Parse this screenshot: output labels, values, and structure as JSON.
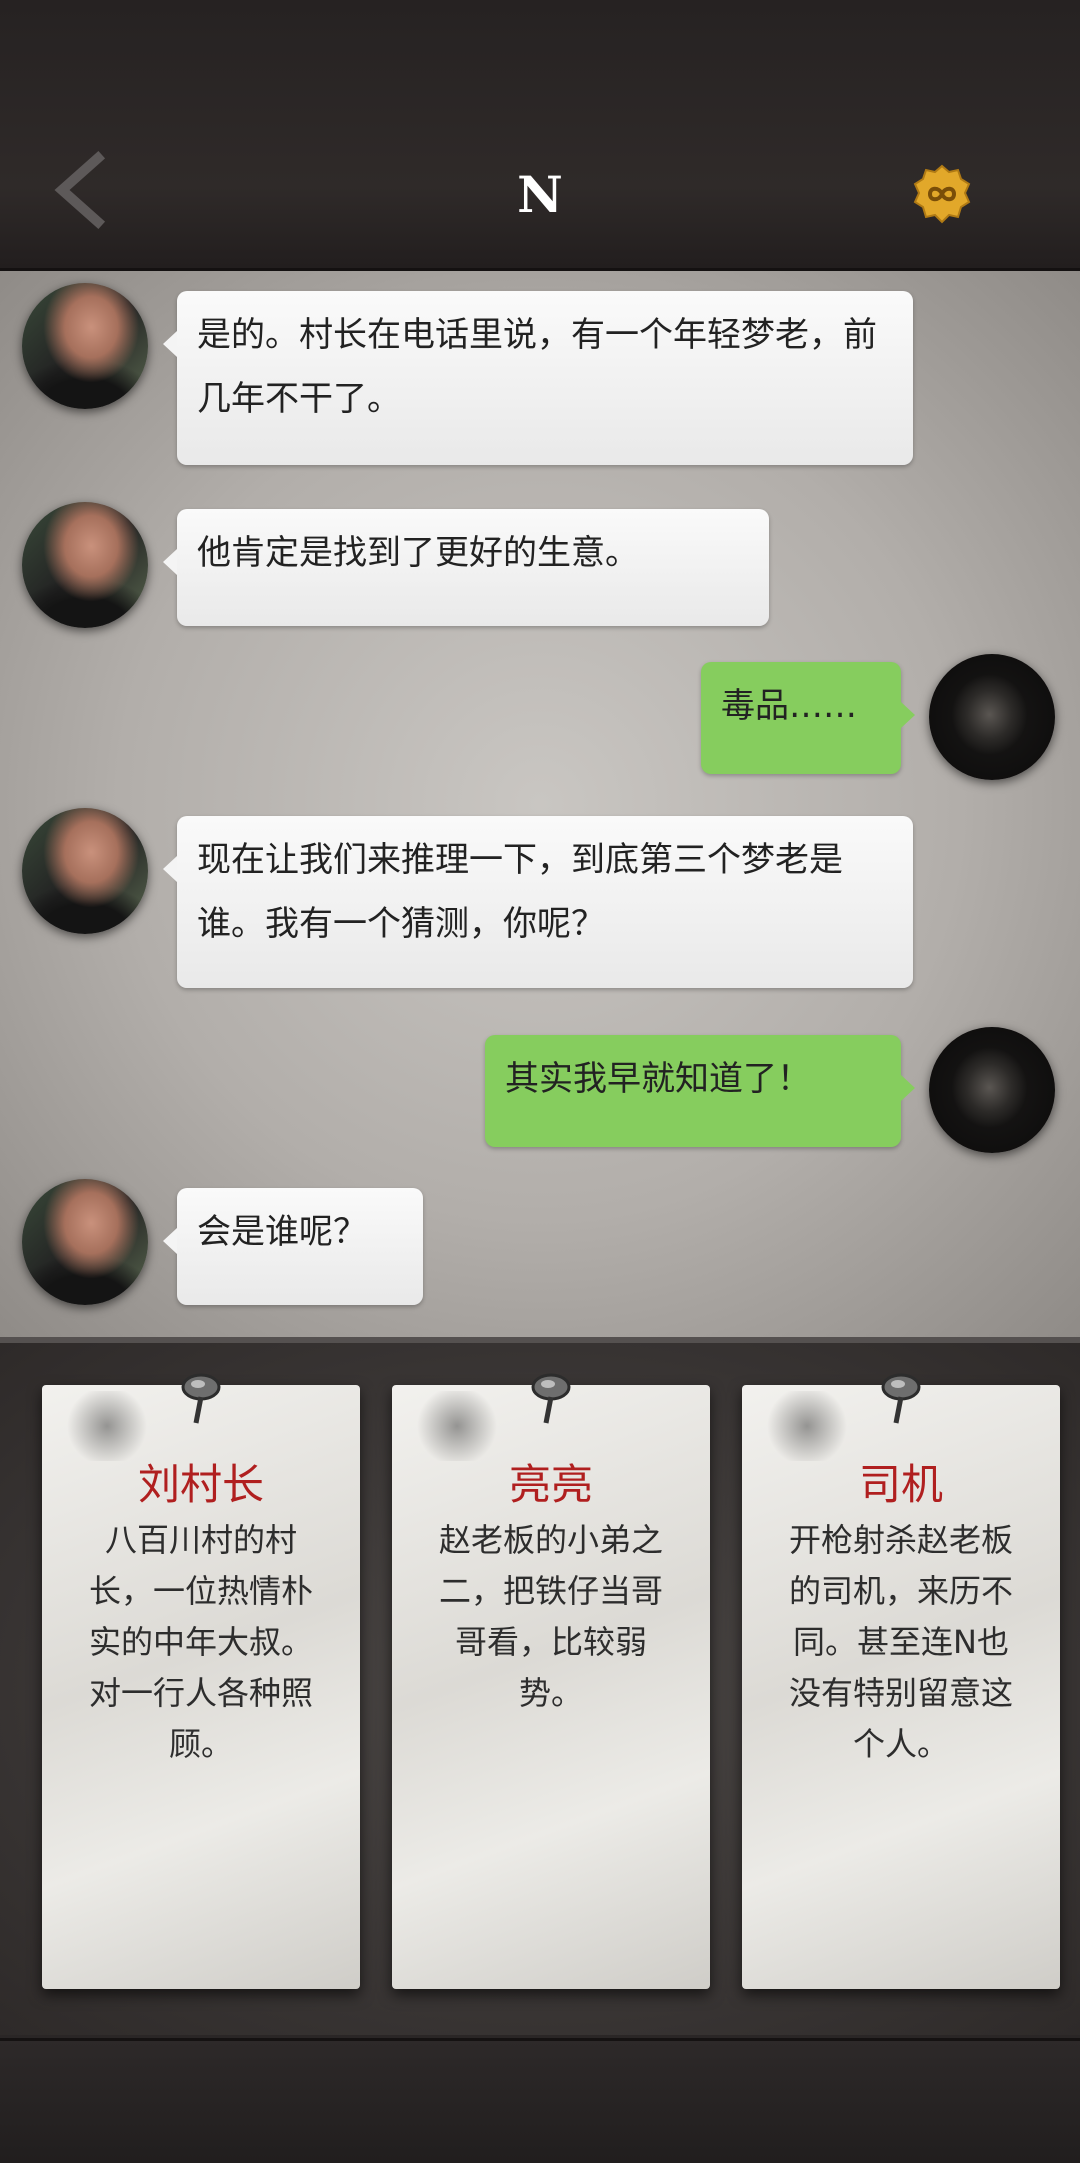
{
  "header": {
    "title": "N",
    "back_icon": "chevron-left-icon",
    "coin_icon": "gold-infinity-coin-icon"
  },
  "messages": [
    {
      "side": "left",
      "text": "是的。村长在电话里说，有一个年轻梦老，前几年不干了。"
    },
    {
      "side": "left",
      "text": "他肯定是找到了更好的生意。"
    },
    {
      "side": "right",
      "text": "毒品……"
    },
    {
      "side": "left",
      "text": "现在让我们来推理一下，到底第三个梦老是谁。我有一个猜测，你呢？"
    },
    {
      "side": "right",
      "text": "其实我早就知道了！"
    },
    {
      "side": "left",
      "text": "会是谁呢？"
    }
  ],
  "cards": [
    {
      "name": "刘村长",
      "desc": "八百川村的村长，一位热情朴实的中年大叔。对一行人各种照顾。"
    },
    {
      "name": "亮亮",
      "desc": "赵老板的小弟之二，把铁仔当哥哥看，比较弱势。"
    },
    {
      "name": "司机",
      "desc": "开枪射杀赵老板的司机，来历不同。甚至连N也没有特别留意这个人。"
    }
  ],
  "colors": {
    "accent_green": "#86cd5e",
    "card_name_red": "#b01f1f",
    "coin_gold": "#e2a82a"
  }
}
